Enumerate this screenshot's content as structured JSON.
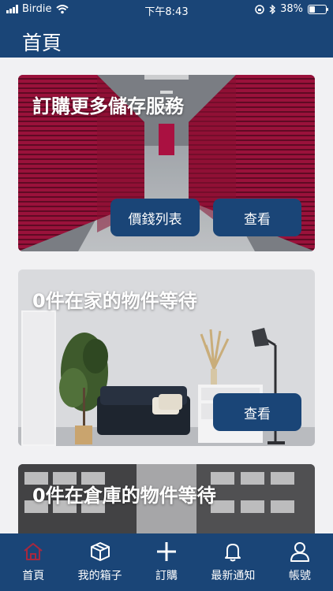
{
  "status_bar": {
    "carrier": "Birdie",
    "time": "下午8:43",
    "battery": "38%",
    "battery_level": 0.38
  },
  "header": {
    "title": "首頁"
  },
  "cards": [
    {
      "title": "訂購更多儲存服務",
      "image": "storage-hallway",
      "buttons": [
        "價錢列表",
        "查看"
      ]
    },
    {
      "title": "0件在家的物件等待",
      "image": "living-room",
      "buttons": [
        "查看"
      ]
    },
    {
      "title": "0件在倉庫的物件等待",
      "image": "warehouse-shelves",
      "buttons": []
    }
  ],
  "tabs": [
    {
      "label": "首頁",
      "icon": "home-icon",
      "active": true
    },
    {
      "label": "我的箱子",
      "icon": "box-icon",
      "active": false
    },
    {
      "label": "訂購",
      "icon": "plus-icon",
      "active": false
    },
    {
      "label": "最新通知",
      "icon": "bell-icon",
      "active": false
    },
    {
      "label": "帳號",
      "icon": "user-icon",
      "active": false
    }
  ],
  "colors": {
    "brand": "#1a4577",
    "active_tab_icon": "#a8283e",
    "background": "#f1f1f3"
  }
}
